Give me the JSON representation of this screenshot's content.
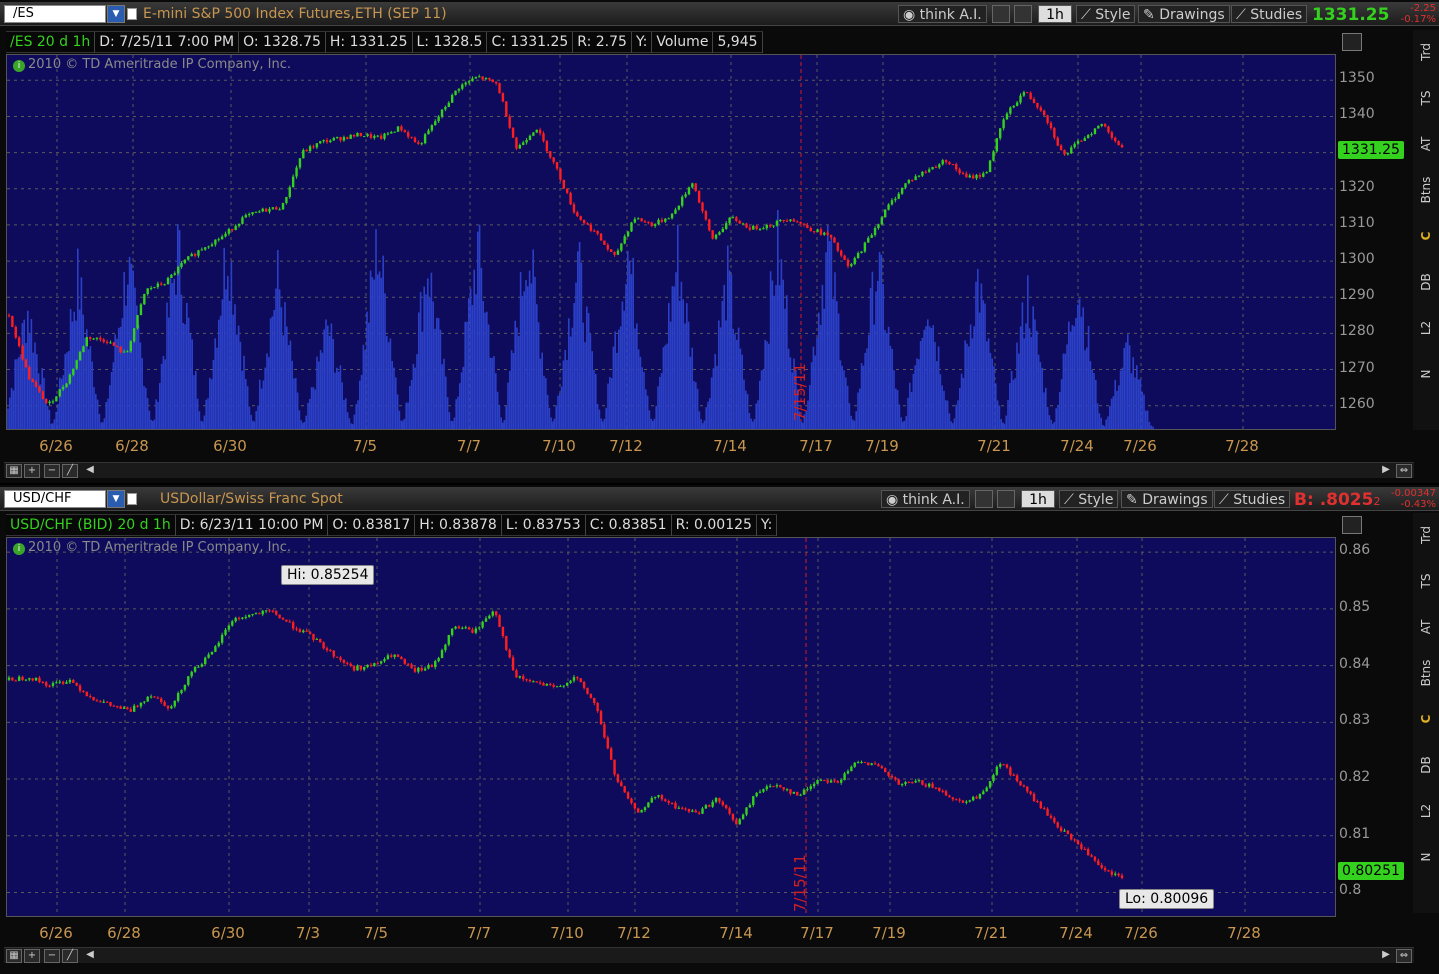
{
  "top": {
    "symbol": "/ES",
    "description": "E-mini S&P 500 Index Futures,ETH (SEP 11)",
    "toolbar": {
      "think": "think A.I.",
      "period": "1h",
      "style": "Style",
      "drawings": "Drawings",
      "studies": "Studies"
    },
    "last": "1331.25",
    "change": "-2.25",
    "change_pct": "-0.17%",
    "header": {
      "title": "/ES 20 d 1h",
      "d": "D: 7/25/11 7:00 PM",
      "o": "O: 1328.75",
      "h": "H: 1331.25",
      "l": "L: 1328.5",
      "c": "C: 1331.25",
      "r": "R: 2.75",
      "y": "Y:",
      "vol_label": "Volume",
      "vol": "5,945"
    },
    "copyright": "2010 © TD Ameritrade IP Company, Inc.",
    "price_tag": "1331.25",
    "marker_date": "7/15/11"
  },
  "bottom": {
    "symbol": "USD/CHF",
    "description": "USDollar/Swiss Franc Spot",
    "toolbar": {
      "think": "think A.I.",
      "period": "1h",
      "style": "Style",
      "drawings": "Drawings",
      "studies": "Studies"
    },
    "last_prefix": "B: ",
    "last": ".8025",
    "last_sub": "2",
    "change": "-0.00347",
    "change_pct": "-0.43%",
    "header": {
      "title": "USD/CHF (BID) 20 d 1h",
      "d": "D: 6/23/11 10:00 PM",
      "o": "O: 0.83817",
      "h": "H: 0.83878",
      "l": "L: 0.83753",
      "c": "C: 0.83851",
      "r": "R: 0.00125",
      "y": "Y:"
    },
    "copyright": "2010 © TD Ameritrade IP Company, Inc.",
    "price_tag": "0.80251",
    "hi_label": "Hi: 0.85254",
    "lo_label": "Lo: 0.80096",
    "marker_date": "7/15/11"
  },
  "sidebar": [
    "Trd",
    "TS",
    "AT",
    "Btns",
    "C",
    "DB",
    "L2",
    "N"
  ],
  "colors": {
    "up": "#34d11e",
    "down": "#ff1e1e",
    "volume": "#2b40c8",
    "plot_bg": "#0e0b5c",
    "grid": "#5a5a5a",
    "date_label": "#c89650",
    "marker": "#d02020"
  },
  "chart_data": [
    {
      "type": "line",
      "instrument": "/ES",
      "x_labels": [
        "6/26",
        "6/28",
        "6/30",
        "7/5",
        "7/7",
        "7/10",
        "7/12",
        "7/14",
        "7/17",
        "7/19",
        "7/21",
        "7/24",
        "7/26",
        "7/28"
      ],
      "y_ticks": [
        1260,
        1270,
        1280,
        1290,
        1300,
        1310,
        1320,
        1330,
        1340,
        1350
      ],
      "ylim": [
        1253,
        1357
      ],
      "series": [
        {
          "values": [
            1285,
            1268,
            1260,
            1267,
            1279,
            1278,
            1274,
            1292,
            1294,
            1300,
            1304,
            1307,
            1312,
            1314,
            1315,
            1330,
            1333,
            1334,
            1335,
            1334,
            1337,
            1332,
            1340,
            1348,
            1351,
            1349,
            1331,
            1337,
            1326,
            1313,
            1308,
            1301,
            1312,
            1310,
            1313,
            1322,
            1306,
            1312,
            1309,
            1310,
            1312,
            1309,
            1307,
            1298,
            1306,
            1315,
            1322,
            1325,
            1328,
            1323,
            1324,
            1340,
            1347,
            1341,
            1329,
            1334,
            1338,
            1331
          ]
        }
      ],
      "volume_peaks": [
        0.4,
        0.5,
        0.55,
        0.6,
        0.62,
        0.5,
        0.35,
        0.62,
        0.55,
        0.6,
        0.62,
        0.55,
        0.6,
        0.58,
        0.5,
        0.6,
        0.62,
        0.55,
        0.45,
        0.5,
        0.45,
        0.5,
        0.28
      ],
      "marker": "7/15/11",
      "grid": true
    },
    {
      "type": "line",
      "instrument": "USD/CHF",
      "x_labels": [
        "6/26",
        "6/28",
        "6/30",
        "7/3",
        "7/5",
        "7/7",
        "7/10",
        "7/12",
        "7/14",
        "7/17",
        "7/19",
        "7/21",
        "7/24",
        "7/26",
        "7/28"
      ],
      "y_ticks": [
        0.8,
        0.81,
        0.82,
        0.83,
        0.84,
        0.85,
        0.86
      ],
      "ylim": [
        0.7955,
        0.8625
      ],
      "series": [
        {
          "values": [
            0.8375,
            0.838,
            0.8365,
            0.8375,
            0.8345,
            0.833,
            0.832,
            0.835,
            0.8325,
            0.839,
            0.842,
            0.848,
            0.849,
            0.8495,
            0.847,
            0.845,
            0.842,
            0.8395,
            0.84,
            0.842,
            0.839,
            0.84,
            0.847,
            0.846,
            0.85,
            0.838,
            0.837,
            0.836,
            0.838,
            0.833,
            0.82,
            0.814,
            0.817,
            0.815,
            0.814,
            0.8165,
            0.812,
            0.818,
            0.819,
            0.817,
            0.82,
            0.8195,
            0.8235,
            0.822,
            0.819,
            0.8195,
            0.818,
            0.816,
            0.817,
            0.823,
            0.819,
            0.815,
            0.811,
            0.808,
            0.804,
            0.8025
          ]
        }
      ],
      "hi": 0.85254,
      "lo": 0.80096,
      "marker": "7/15/11",
      "grid": true
    }
  ]
}
